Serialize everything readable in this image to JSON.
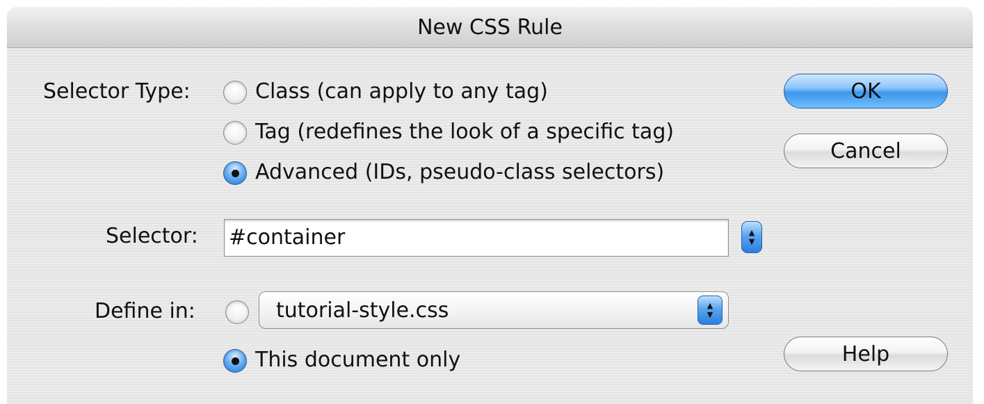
{
  "window": {
    "title": "New CSS Rule"
  },
  "selector_type": {
    "label": "Selector Type:",
    "options": [
      {
        "label": "Class (can apply to any tag)",
        "selected": false
      },
      {
        "label": "Tag (redefines the look of a specific tag)",
        "selected": false
      },
      {
        "label": "Advanced (IDs, pseudo-class selectors)",
        "selected": true
      }
    ]
  },
  "selector": {
    "label": "Selector:",
    "value": "#container"
  },
  "define_in": {
    "label": "Define in:",
    "file_option_selected": false,
    "file_value": "tutorial-style.css",
    "document_only_label": "This document only",
    "document_only_selected": true
  },
  "buttons": {
    "ok": "OK",
    "cancel": "Cancel",
    "help": "Help"
  },
  "colors": {
    "accent": "#3d95ea",
    "stripe_light": "#ececec",
    "stripe_dark": "#e4e4e4"
  },
  "icons": {
    "stepper": "up-down-arrows-icon",
    "popup": "up-down-arrows-icon"
  }
}
